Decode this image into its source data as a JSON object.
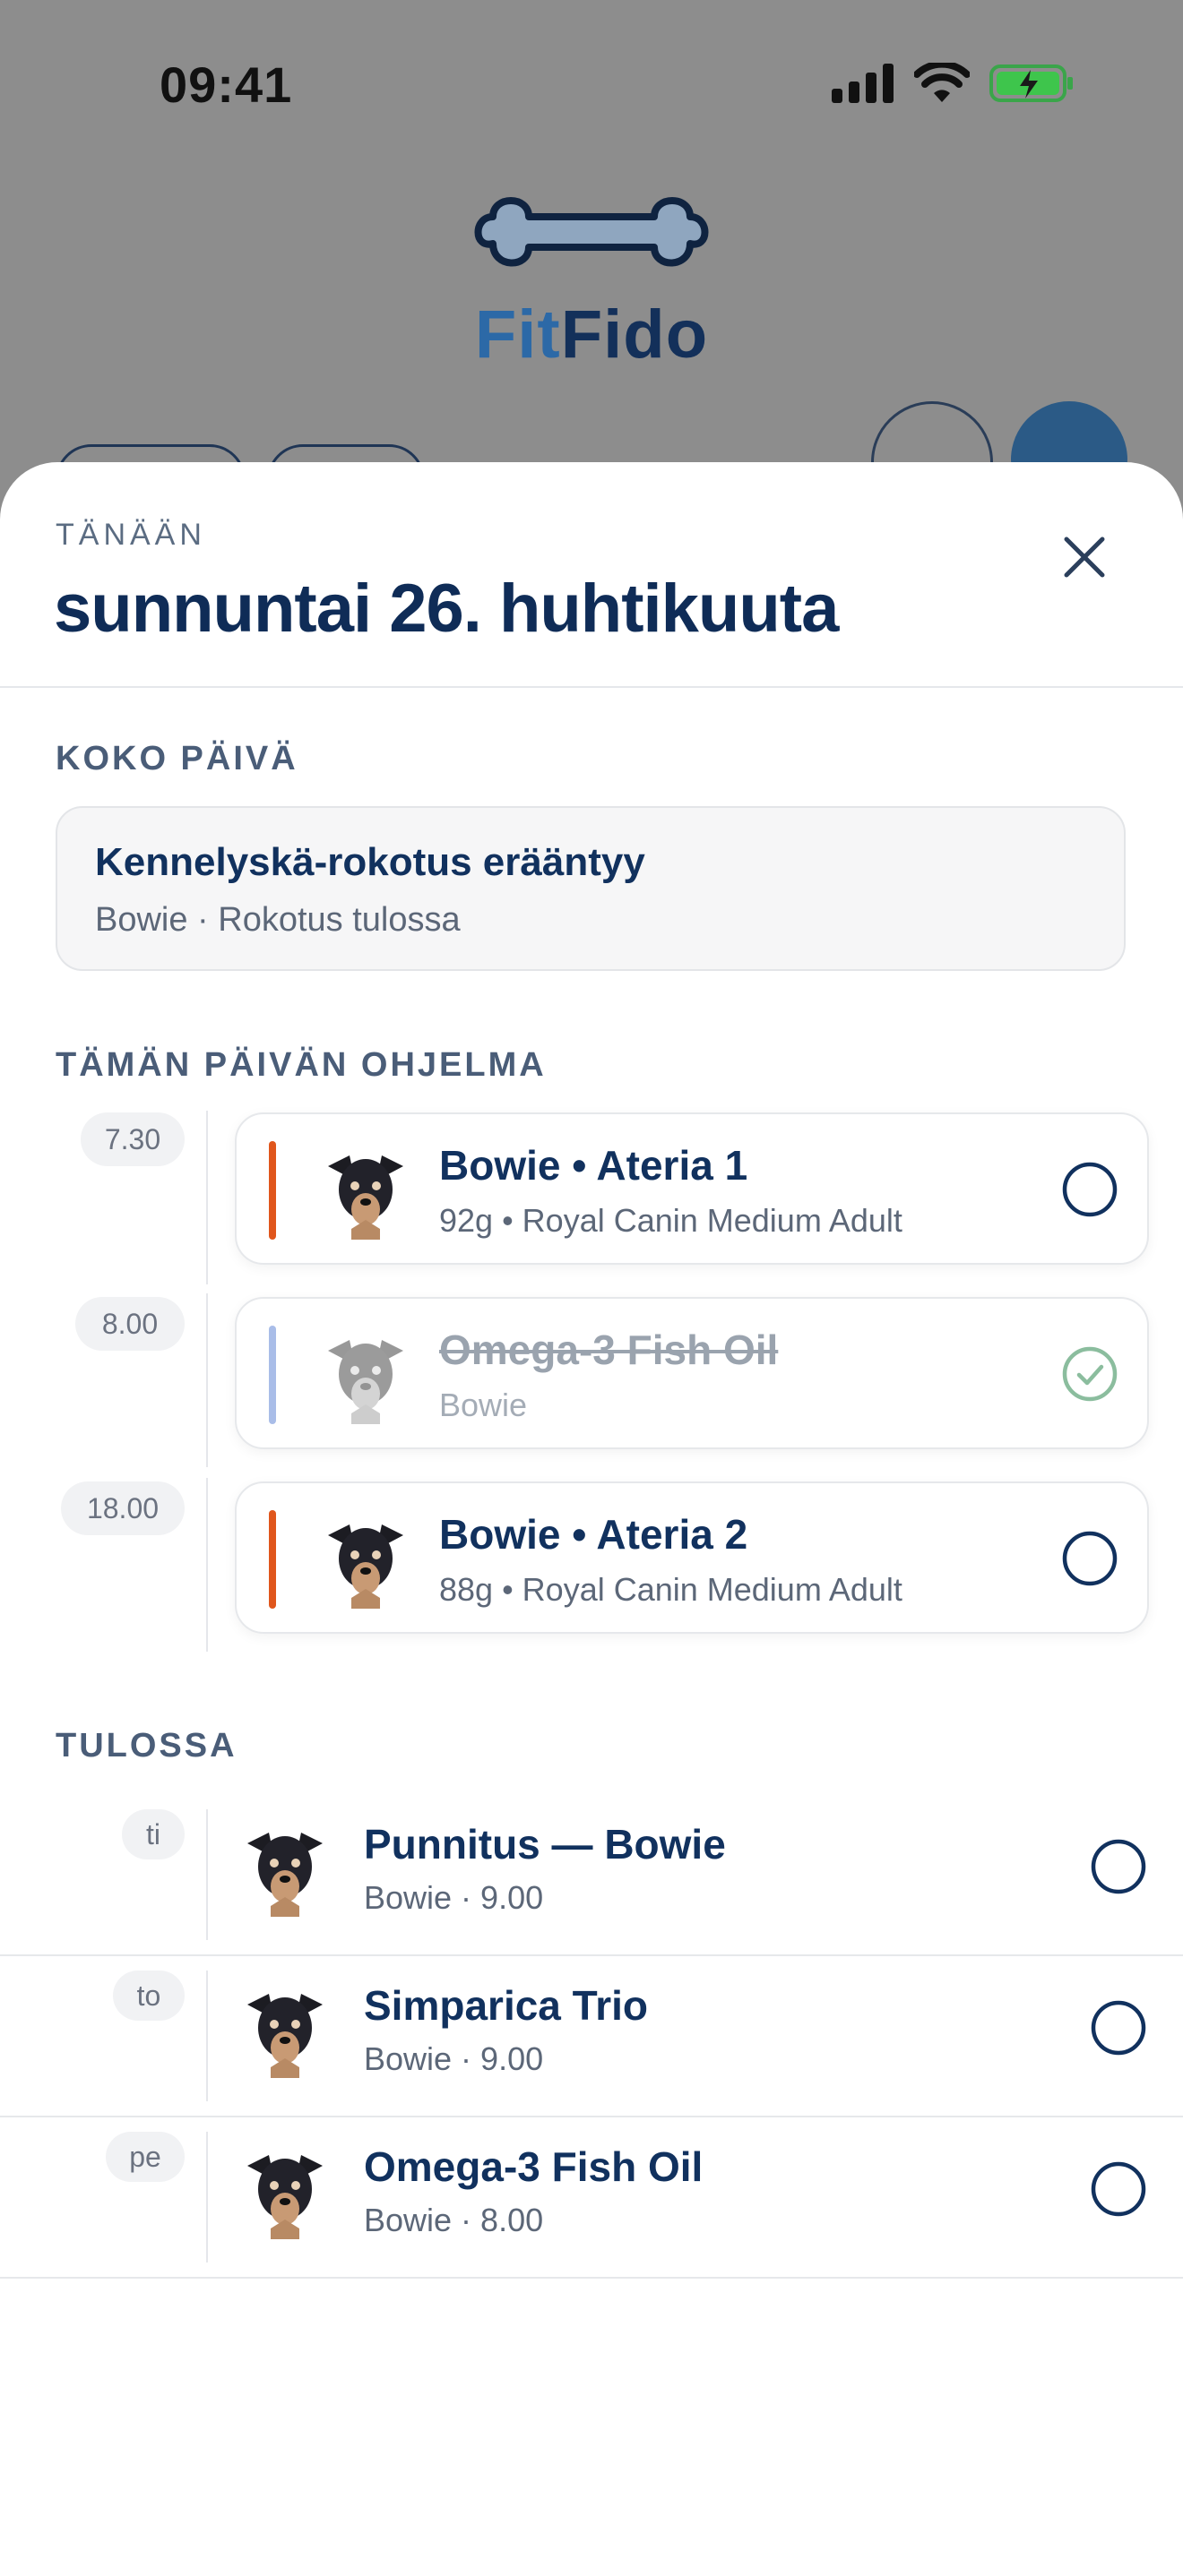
{
  "status_bar": {
    "time": "09:41"
  },
  "logo": {
    "text_a": "Fit",
    "text_b": "Fido"
  },
  "sheet": {
    "eyebrow": "TÄNÄÄN",
    "title": "sunnuntai 26. huhtikuuta",
    "close_icon": "close-icon"
  },
  "all_day": {
    "label": "KOKO PÄIVÄ",
    "card": {
      "title": "Kennelyskä-rokotus erääntyy",
      "subtitle": "Bowie · Rokotus tulossa"
    }
  },
  "program": {
    "label": "TÄMÄN PÄIVÄN OHJELMA",
    "items": [
      {
        "time": "7.30",
        "title": "Bowie • Ateria 1",
        "subtitle": "92g • Royal Canin Medium Adult",
        "done": false,
        "accent": "#e0561c"
      },
      {
        "time": "8.00",
        "title": "Omega-3 Fish Oil",
        "subtitle": "Bowie",
        "done": true,
        "accent": "#a9bde8"
      },
      {
        "time": "18.00",
        "title": "Bowie • Ateria 2",
        "subtitle": "88g • Royal Canin Medium Adult",
        "done": false,
        "accent": "#e0561c"
      }
    ]
  },
  "upcoming": {
    "label": "TULOSSA",
    "items": [
      {
        "day": "ti",
        "title": "Punnitus — Bowie",
        "subtitle": "Bowie · 9.00"
      },
      {
        "day": "to",
        "title": "Simparica Trio",
        "subtitle": "Bowie · 9.00"
      },
      {
        "day": "pe",
        "title": "Omega-3 Fish Oil",
        "subtitle": "Bowie · 8.00"
      }
    ]
  },
  "colors": {
    "navy": "#11315e",
    "accent_orange": "#e0561c",
    "done_green": "#8bbd9e"
  }
}
